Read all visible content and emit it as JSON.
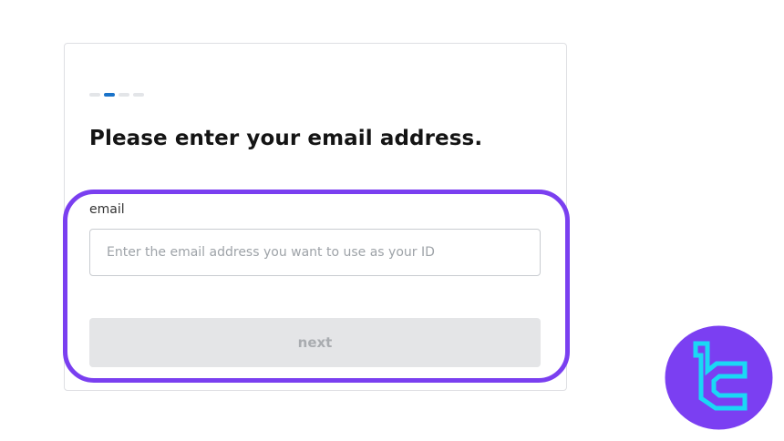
{
  "steps": [
    {
      "active": false
    },
    {
      "active": true
    },
    {
      "active": false
    },
    {
      "active": false
    }
  ],
  "form": {
    "title": "Please enter your email address.",
    "email_label": "email",
    "email_placeholder": "Enter the email address you want to use as your ID",
    "email_value": "",
    "next_label": "next",
    "next_disabled": true
  },
  "colors": {
    "step_active": "#1a73c9",
    "step_inactive": "#e3e5e8",
    "highlight_border": "#7a3ff0",
    "button_disabled_bg": "#e4e5e7",
    "button_disabled_text": "#a9acb0",
    "logo_circle": "#7b3ff2",
    "logo_mark": "#1ad8f5"
  },
  "logo": {
    "icon": "brand-logo-icon"
  }
}
